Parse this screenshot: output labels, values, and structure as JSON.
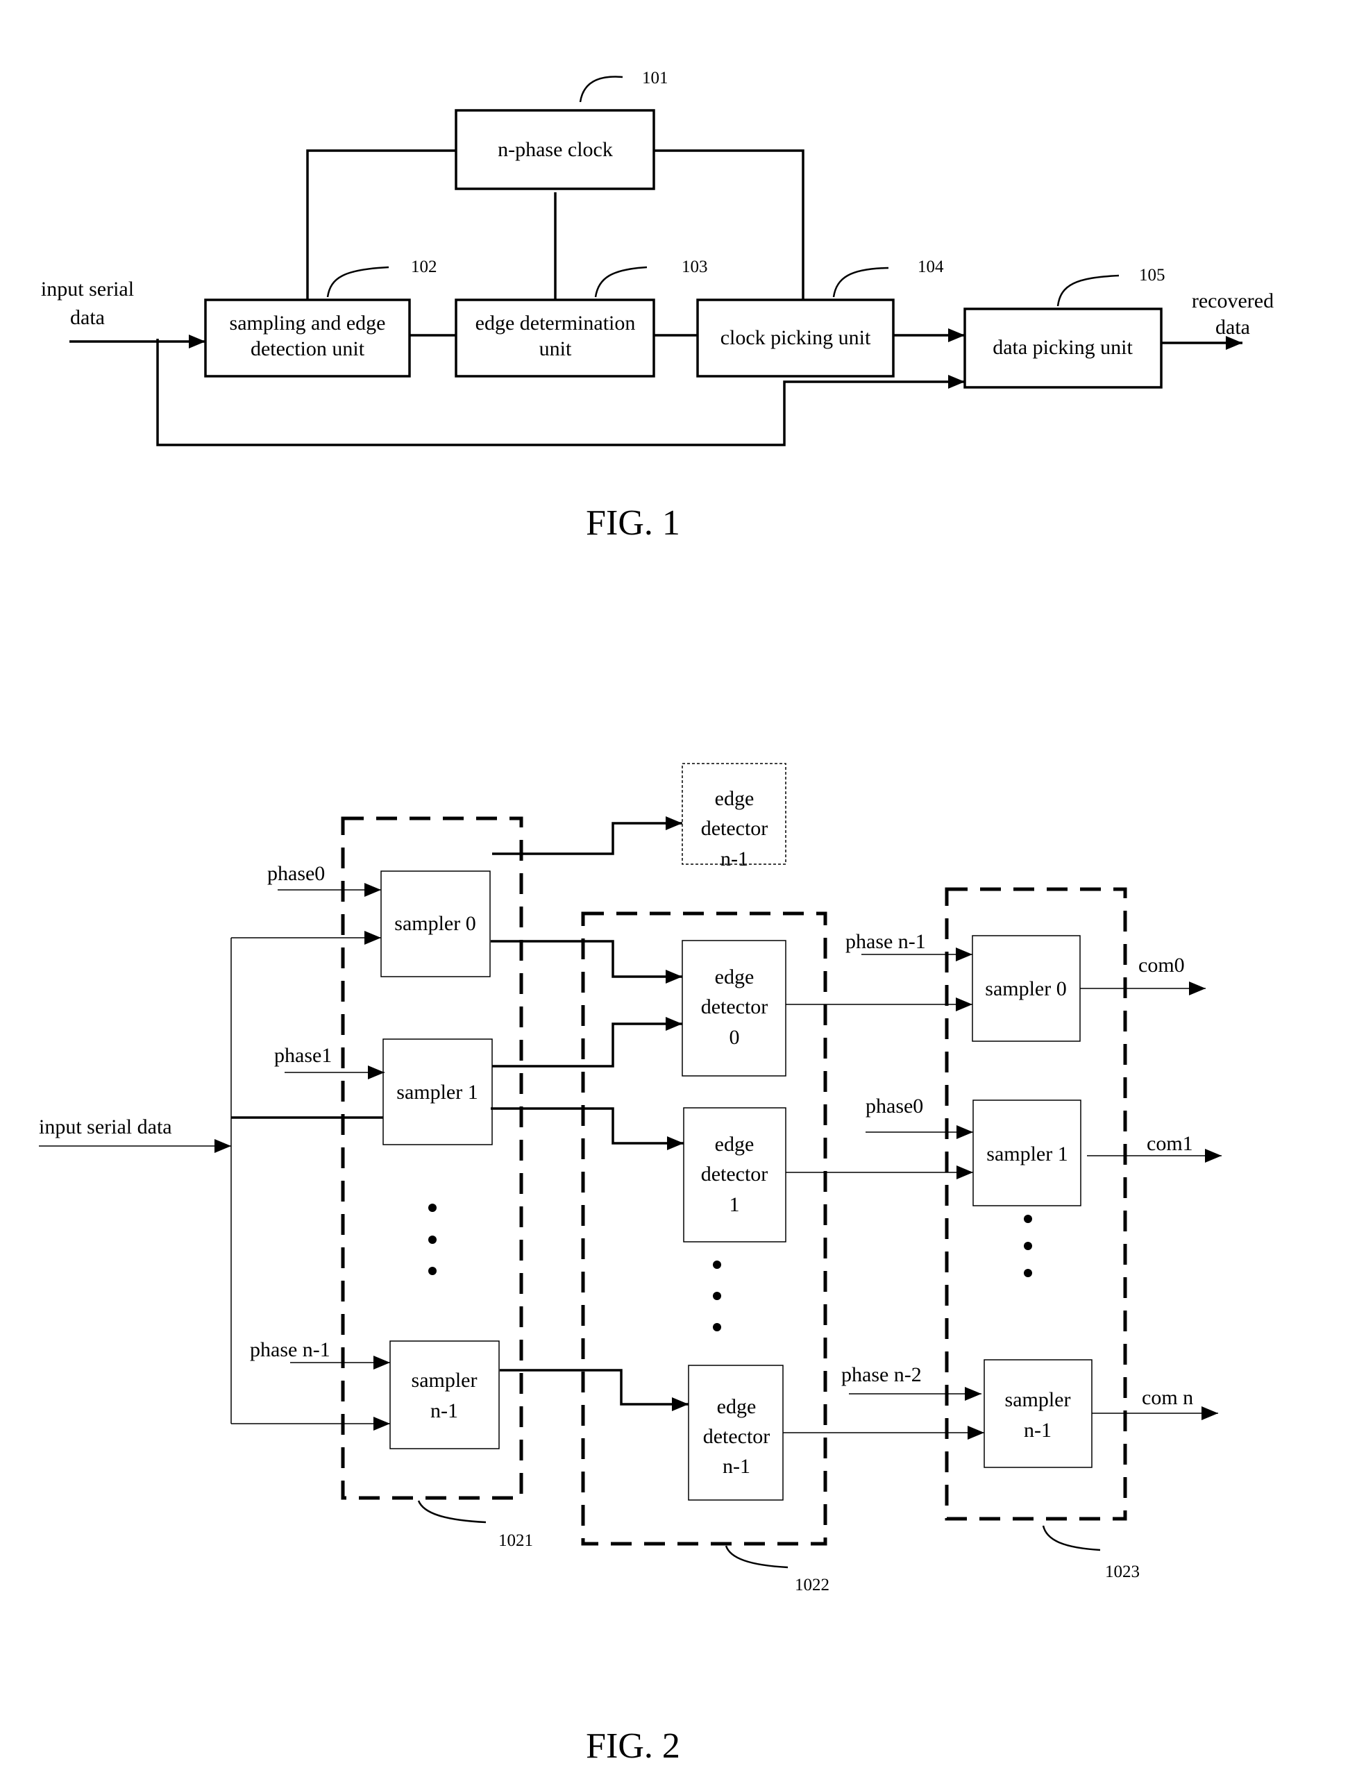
{
  "fig1": {
    "caption": "FIG. 1",
    "blocks": {
      "n_phase_clock": {
        "label": "n-phase clock",
        "ref": "101"
      },
      "sampling_edge": {
        "line1": "sampling and edge",
        "line2": "detection unit",
        "ref": "102"
      },
      "edge_determination": {
        "line1": "edge determination",
        "line2": "unit",
        "ref": "103"
      },
      "clock_picking": {
        "label": "clock picking unit",
        "ref": "104"
      },
      "data_picking": {
        "label": "data picking unit",
        "ref": "105"
      }
    },
    "input_label": {
      "line1": "input serial",
      "line2": "data"
    },
    "output_label": {
      "line1": "recovered",
      "line2": "data"
    }
  },
  "fig2": {
    "caption": "FIG. 2",
    "input_label": "input serial data",
    "groups": {
      "samplers": {
        "ref": "1021"
      },
      "edge_detectors": {
        "ref": "1022"
      },
      "output_samplers": {
        "ref": "1023"
      }
    },
    "stage1": [
      {
        "phase": "phase0",
        "line1": "sampler 0",
        "line2": ""
      },
      {
        "phase": "phase1",
        "line1": "sampler 1",
        "line2": ""
      },
      {
        "phase": "phase n-1",
        "line1": "sampler",
        "line2": "n-1"
      }
    ],
    "edge_detectors": [
      {
        "line1": "edge",
        "line2": "detector",
        "line3": "n-1",
        "ghost": true
      },
      {
        "line1": "edge",
        "line2": "detector",
        "line3": "0"
      },
      {
        "line1": "edge",
        "line2": "detector",
        "line3": "1"
      },
      {
        "line1": "edge",
        "line2": "detector",
        "line3": "n-1"
      }
    ],
    "stage3": [
      {
        "phase": "phase n-1",
        "line1": "sampler 0",
        "line2": "",
        "output": "com0"
      },
      {
        "phase": "phase0",
        "line1": "sampler 1",
        "line2": "",
        "output": "com1"
      },
      {
        "phase": "phase n-2",
        "line1": "sampler",
        "line2": "n-1",
        "output": "com n"
      }
    ]
  }
}
